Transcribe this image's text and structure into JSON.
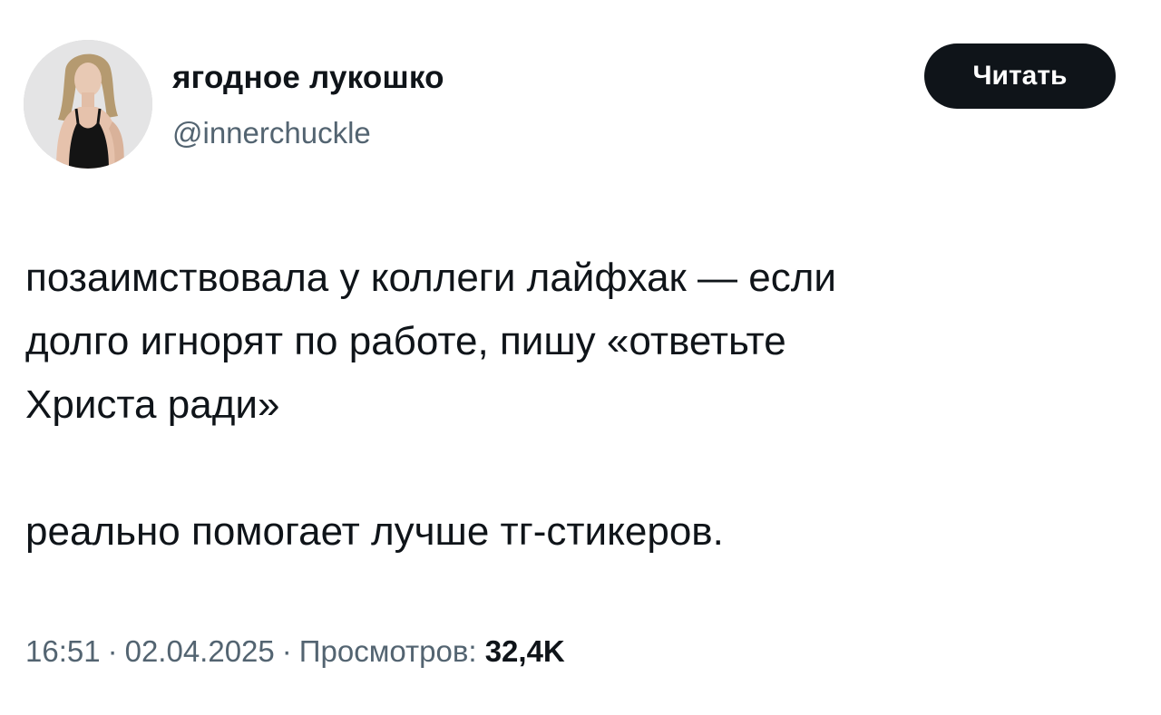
{
  "tweet": {
    "author": {
      "display_name": "ягодное лукошко",
      "handle": "@innerchuckle",
      "avatar_icon": "profile-photo"
    },
    "read_button_label": "Читать",
    "text_lines": [
      "позаимствовала у коллеги лайфхак — если",
      "долго игнорят по работе, пишу «ответьте",
      "Христа ради»"
    ],
    "text_paragraph_2": "реально помогает лучше тг-стикеров.",
    "time": "16:51",
    "date": "02.04.2025",
    "views_label": "Просмотров:",
    "views_count": "32,4K",
    "separator": "·"
  },
  "colors": {
    "text_primary": "#0f1419",
    "text_secondary": "#536471",
    "button_bg": "#0f1419",
    "button_text": "#ffffff",
    "background": "#ffffff"
  }
}
